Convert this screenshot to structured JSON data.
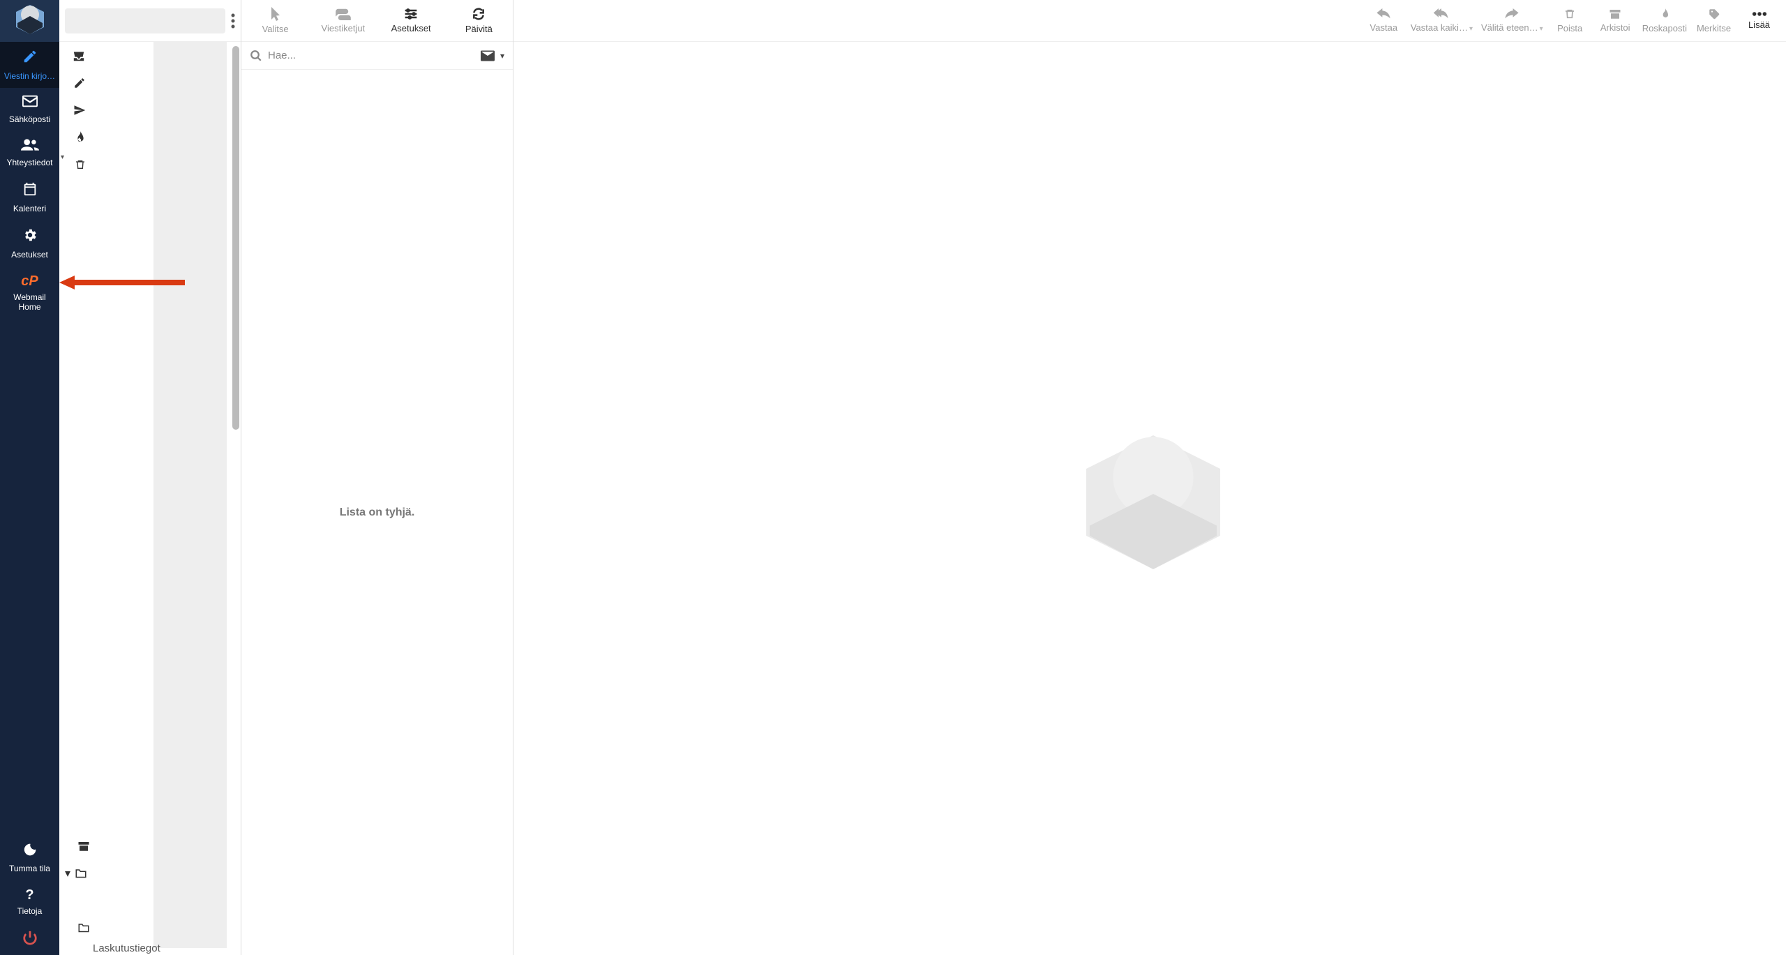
{
  "nav": {
    "compose": "Viestin kirjo…",
    "mail": "Sähköposti",
    "contacts": "Yhteystiedot",
    "calendar": "Kalenteri",
    "settings": "Asetukset",
    "webmail_home": "Webmail Home",
    "dark_mode": "Tumma tila",
    "about": "Tietoja"
  },
  "toolbar_left": {
    "select": "Valitse",
    "threads": "Viestiketjut",
    "options": "Asetukset",
    "refresh": "Päivitä"
  },
  "toolbar_right": {
    "reply": "Vastaa",
    "reply_all": "Vastaa kaiki…",
    "forward": "Välitä eteen…",
    "delete": "Poista",
    "archive": "Arkistoi",
    "junk": "Roskaposti",
    "mark": "Merkitse",
    "more": "Lisää"
  },
  "search": {
    "placeholder": "Hae..."
  },
  "messages": {
    "empty": "Lista on tyhjä."
  },
  "folders": {
    "visible_label": "Laskutustiegot"
  }
}
